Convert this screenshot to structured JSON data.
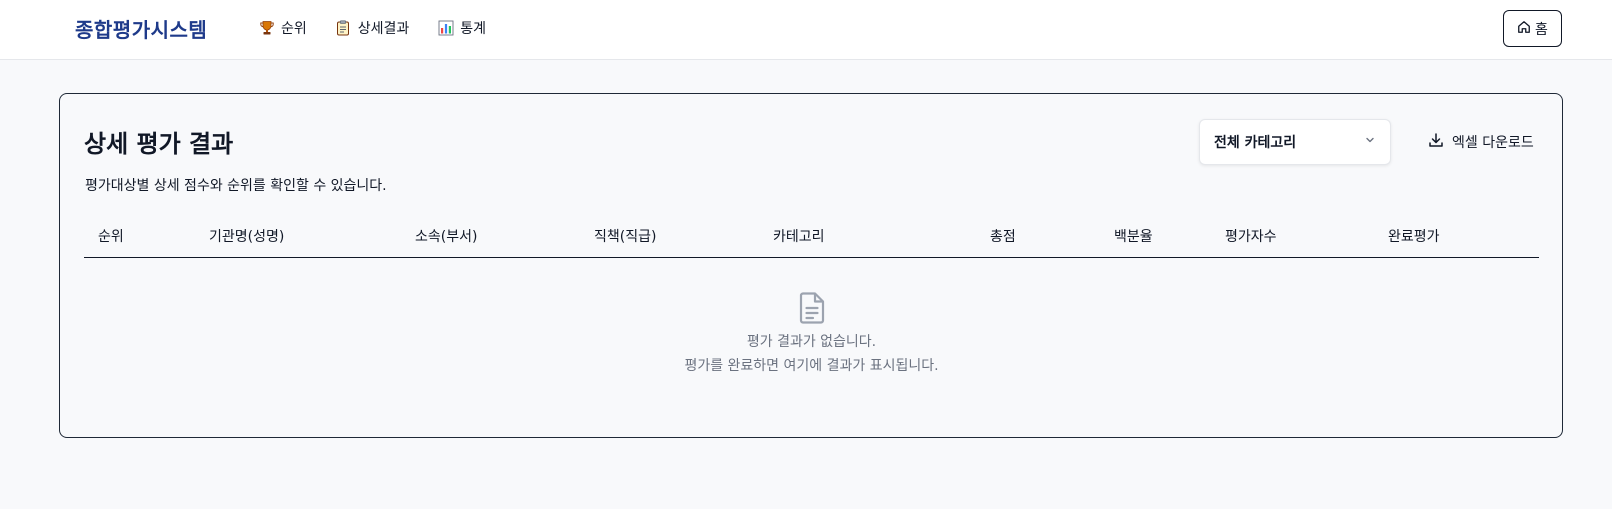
{
  "header": {
    "brand": "종합평가시스템",
    "nav": [
      {
        "label": "순위",
        "icon": "trophy-icon"
      },
      {
        "label": "상세결과",
        "icon": "clipboard-icon"
      },
      {
        "label": "통계",
        "icon": "bar-chart-icon"
      }
    ],
    "home_label": "홈",
    "home_icon": "home-icon"
  },
  "main": {
    "title": "상세 평가 결과",
    "description": "평가대상별 상세 점수와 순위를 확인할 수 있습니다.",
    "category_select": {
      "value": "전체 카테고리",
      "icon": "chevron-down-icon"
    },
    "download_button": {
      "label": "엑셀 다운로드",
      "icon": "download-icon"
    },
    "table": {
      "columns": [
        "순위",
        "기관명(성명)",
        "소속(부서)",
        "직책(직급)",
        "카테고리",
        "총점",
        "백분율",
        "평가자수",
        "완료평가"
      ]
    },
    "empty_state": {
      "icon": "document-icon",
      "line1": "평가 결과가 없습니다.",
      "line2": "평가를 완료하면 여기에 결과가 표시됩니다."
    }
  },
  "colors": {
    "brand": "#1e3a8a",
    "background": "#f8f9fb",
    "muted_text": "#6b7280"
  }
}
